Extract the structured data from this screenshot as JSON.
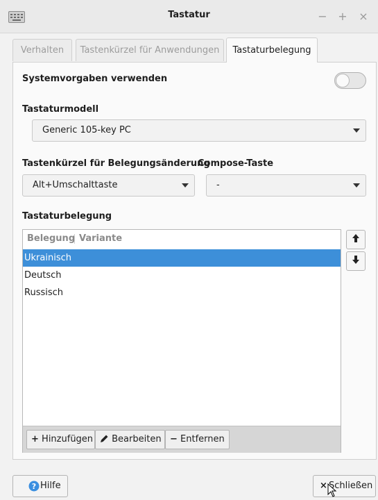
{
  "window": {
    "title": "Tastatur",
    "minimize": "−",
    "maximize": "+",
    "close": "×"
  },
  "tabs": [
    {
      "label": "Verhalten",
      "active": false
    },
    {
      "label": "Tastenkürzel für Anwendungen",
      "active": false
    },
    {
      "label": "Tastaturbelegung",
      "active": true
    }
  ],
  "settings": {
    "defaults_label": "Systemvorgaben verwenden",
    "defaults_on": false,
    "model_label": "Tastaturmodell",
    "model_value": "Generic 105-key PC",
    "switch_label": "Tastenkürzel für Belegungsänderung",
    "switch_value": "Alt+Umschalttaste",
    "compose_label": "Compose-Taste",
    "compose_value": "-"
  },
  "layouts": {
    "section_label": "Tastaturbelegung",
    "columns": [
      "Belegung",
      "Variante"
    ],
    "rows": [
      {
        "name": "Ukrainisch",
        "variant": "",
        "selected": true
      },
      {
        "name": "Deutsch",
        "variant": "",
        "selected": false
      },
      {
        "name": "Russisch",
        "variant": "",
        "selected": false
      }
    ],
    "add_label": "Hinzufügen",
    "edit_label": "Bearbeiten",
    "remove_label": "Entfernen",
    "add_icon": "+",
    "remove_icon": "−"
  },
  "footer": {
    "help_label": "Hilfe",
    "close_label": "Schließen",
    "close_icon": "×"
  },
  "colors": {
    "selection": "#3d8fd9",
    "help_icon": "#3b8fe0"
  }
}
